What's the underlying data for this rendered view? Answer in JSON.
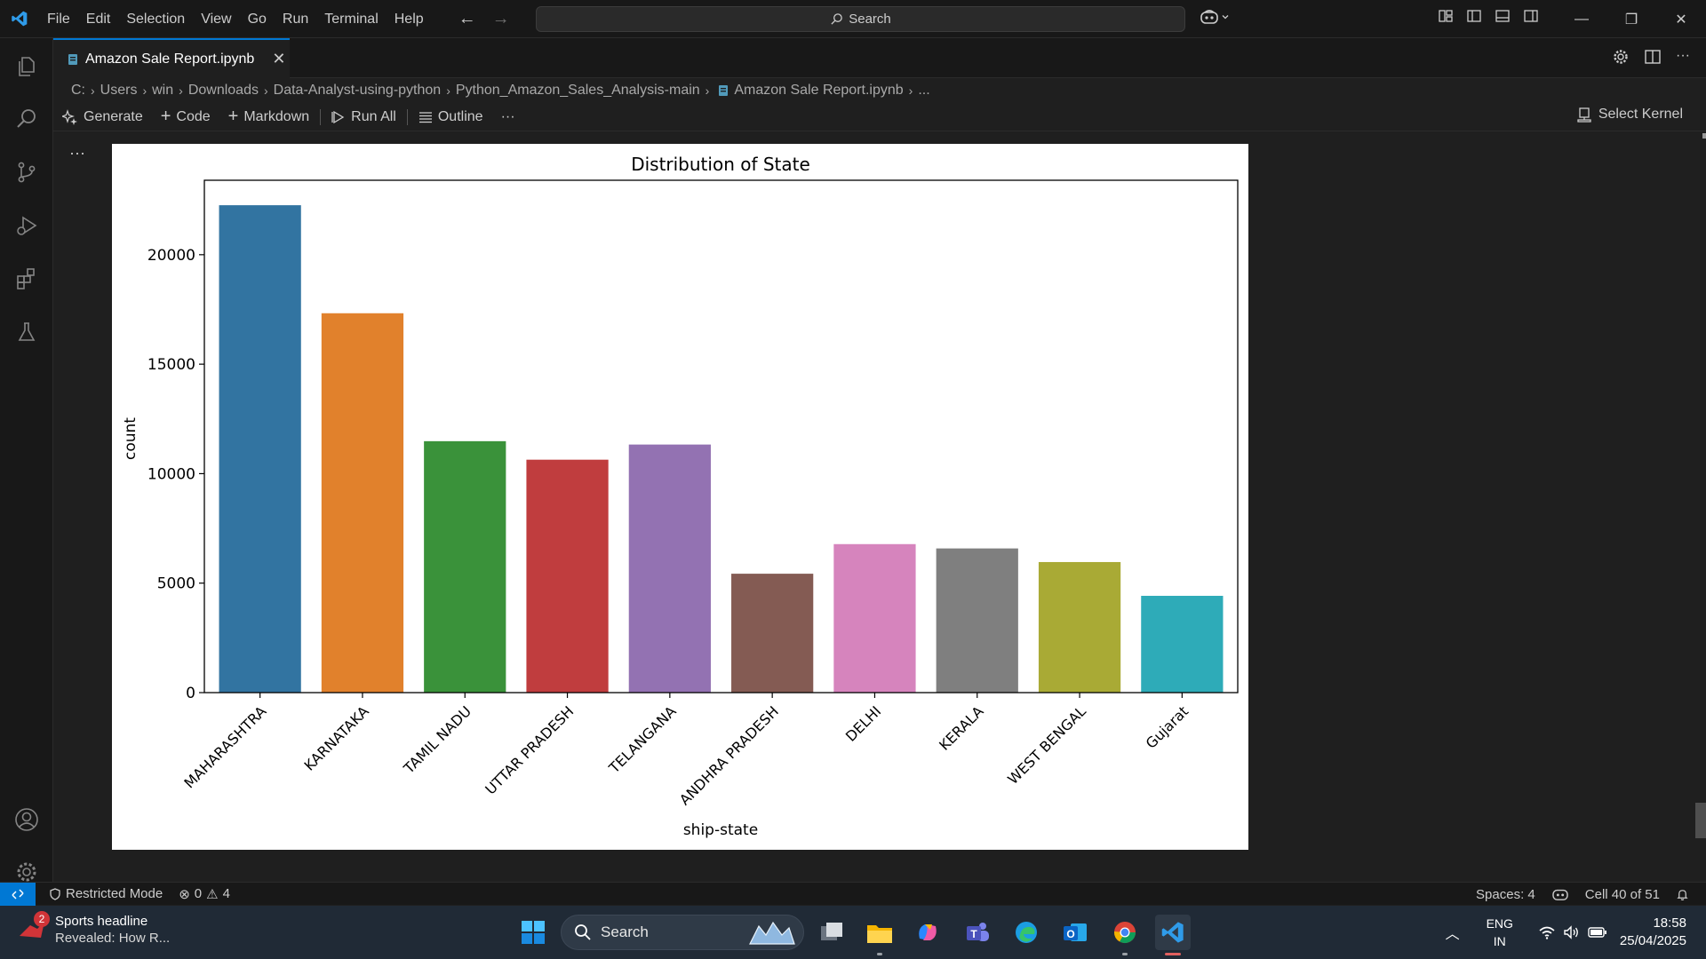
{
  "menu": [
    "File",
    "Edit",
    "Selection",
    "View",
    "Go",
    "Run",
    "Terminal",
    "Help"
  ],
  "command_center": {
    "label": "Search"
  },
  "tab": {
    "title": "Amazon Sale Report.ipynb"
  },
  "breadcrumb": [
    "C:",
    "Users",
    "win",
    "Downloads",
    "Data-Analyst-using-python",
    "Python_Amazon_Sales_Analysis-main",
    "Amazon Sale Report.ipynb",
    "..."
  ],
  "notebook_toolbar": {
    "generate": "Generate",
    "code": "Code",
    "markdown": "Markdown",
    "run_all": "Run All",
    "outline": "Outline",
    "more": "···",
    "kernel": "Select Kernel"
  },
  "cell": {
    "ellipsis": "···"
  },
  "chart_data": {
    "type": "bar",
    "title": "Distribution of  State",
    "xlabel": "ship-state",
    "ylabel": "count",
    "categories": [
      "MAHARASHTRA",
      "KARNATAKA",
      "TAMIL NADU",
      "UTTAR PRADESH",
      "TELANGANA",
      "ANDHRA PRADESH",
      "DELHI",
      "KERALA",
      "WEST BENGAL",
      "Gujarat"
    ],
    "values": [
      22260,
      17326,
      11483,
      10638,
      11330,
      5430,
      6782,
      6585,
      5963,
      4420
    ],
    "colors": [
      "#3274a1",
      "#e1812c",
      "#3a923a",
      "#c03d3e",
      "#9372b2",
      "#845b53",
      "#d684bd",
      "#7f7f7f",
      "#a9aa35",
      "#2eabb8"
    ],
    "yticks": [
      0,
      5000,
      10000,
      15000,
      20000
    ],
    "ylim": [
      0,
      23400
    ]
  },
  "statusbar": {
    "restricted": "Restricted Mode",
    "errors": "0",
    "warnings": "4",
    "spaces": "Spaces: 4",
    "cell": "Cell 40 of 51"
  },
  "taskbar": {
    "news_badge": "2",
    "news_title": "Sports headline",
    "news_sub": "Revealed: How R...",
    "search": "Search",
    "lang1": "ENG",
    "lang2": "IN",
    "time": "18:58",
    "date": "25/04/2025"
  }
}
